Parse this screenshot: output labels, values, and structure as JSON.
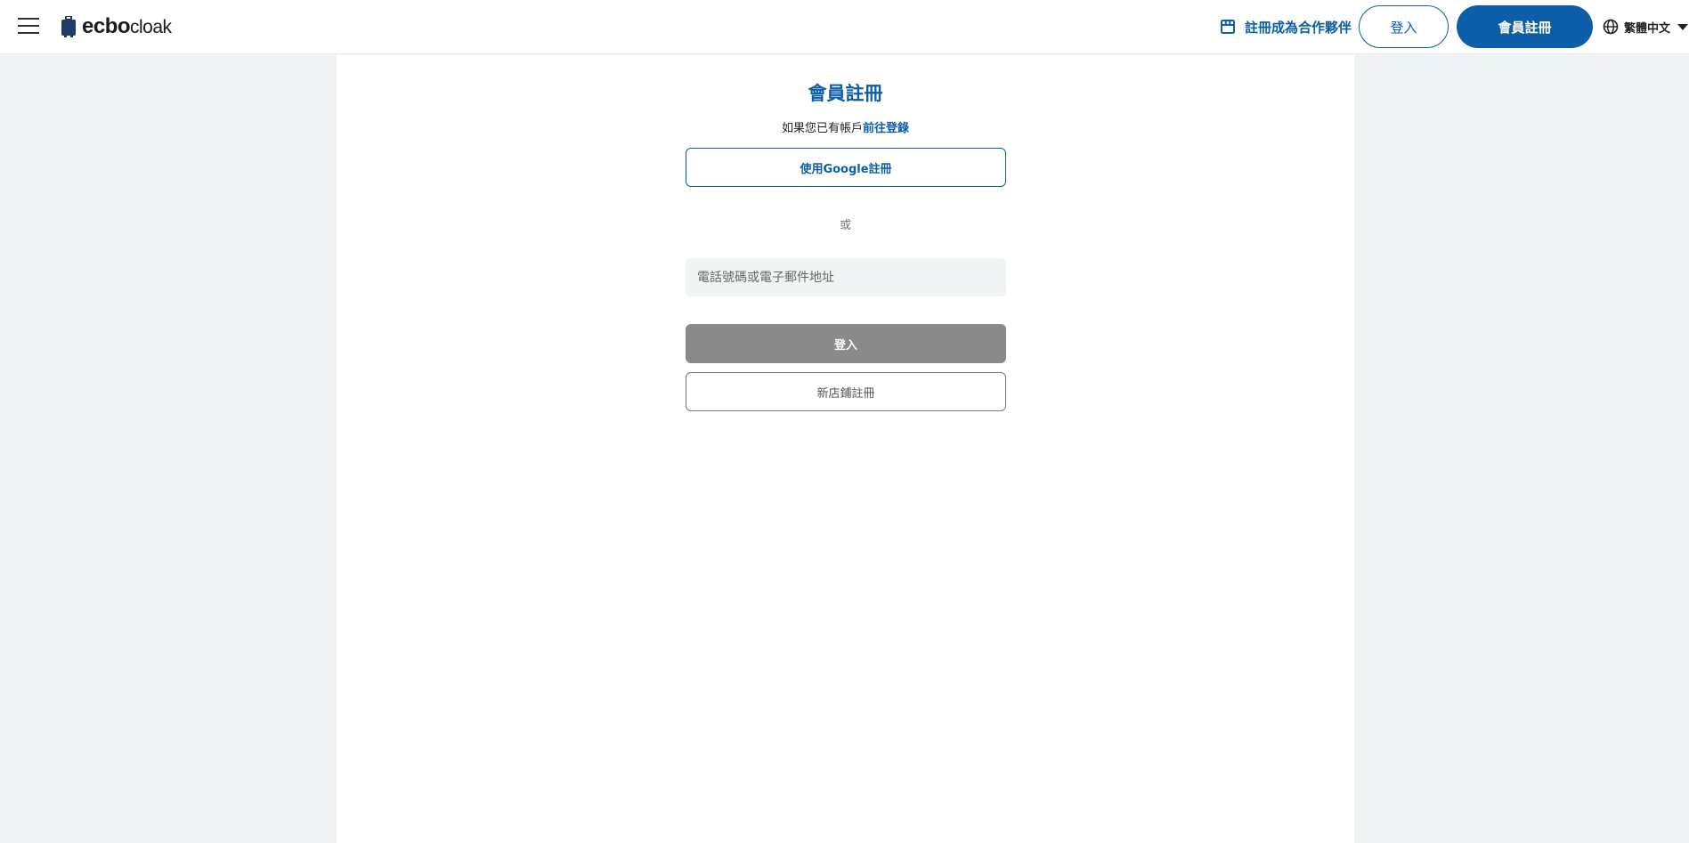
{
  "header": {
    "logo": {
      "brand_bold": "ecbo",
      "brand_light": "cloak"
    },
    "partner_link": "註冊成為合作夥伴",
    "login_button": "登入",
    "signup_button": "會員註冊",
    "language": "繁體中文"
  },
  "form": {
    "title": "會員註冊",
    "subtitle_prefix": "如果您已有帳戶",
    "subtitle_link": "前往登錄",
    "google_button": "使用Google註冊",
    "or_text": "或",
    "contact_placeholder": "電話號碼或電子郵件地址",
    "login_button": "登入",
    "new_store_button": "新店鋪註冊"
  },
  "colors": {
    "brand_blue": "#0c5ea8",
    "disabled_gray": "#8a8a8a",
    "page_bg": "#f2f3f5",
    "input_bg": "#f1f4f7"
  },
  "icons": [
    "menu-icon",
    "suitcase-icon",
    "store-icon",
    "globe-icon",
    "caret-down-icon"
  ]
}
